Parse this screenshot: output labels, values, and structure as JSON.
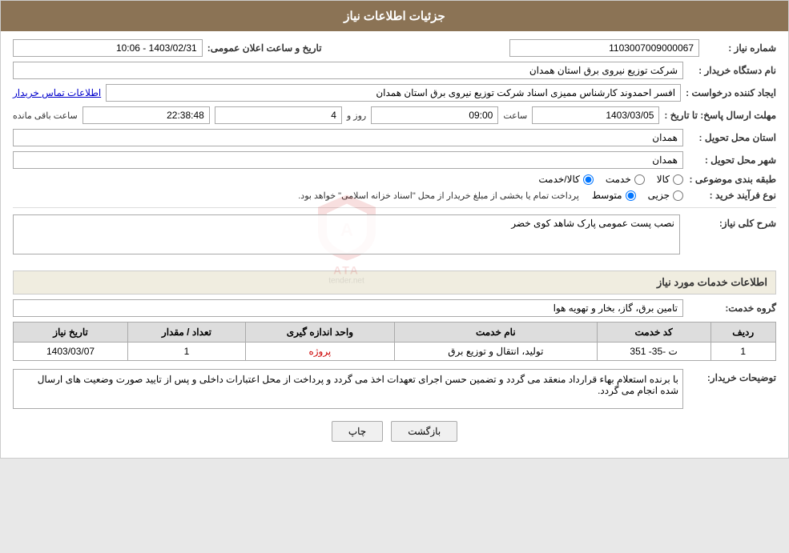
{
  "header": {
    "title": "جزئیات اطلاعات نیاز"
  },
  "fields": {
    "shomara_niaz_label": "شماره نیاز :",
    "shomara_niaz_value": "1103007009000067",
    "nam_dastgah_label": "نام دستگاه خریدار :",
    "nam_dastgah_value": "شرکت توزیع نیروی برق استان همدان",
    "ijad_konande_label": "ایجاد کننده درخواست :",
    "ijad_konande_value": "افسر احمدوند کارشناس ممیزی اسناد شرکت توزیع نیروی برق استان همدان",
    "ijad_konande_link": "اطلاعات تماس خریدار",
    "mohlat_label": "مهلت ارسال پاسخ: تا تاریخ :",
    "mohlat_date": "1403/03/05",
    "mohlat_saat_label": "ساعت",
    "mohlat_saat_value": "09:00",
    "mohlat_rooz_label": "روز و",
    "mohlat_rooz_value": "4",
    "mohlat_remaining_label": "ساعت باقی مانده",
    "mohlat_remaining_value": "22:38:48",
    "ostan_tahvil_label": "استان محل تحویل :",
    "ostan_tahvil_value": "همدان",
    "shahr_tahvil_label": "شهر محل تحویل :",
    "shahr_tahvil_value": "همدان",
    "tasnifbandi_label": "طبقه بندی موضوعی :",
    "tasnifbandi_kala": "کالا",
    "tasnifbandi_khedmat": "خدمت",
    "tasnifbandi_kala_khedmat": "کالا/خدمت",
    "nooe_farayand_label": "نوع فرآیند خرید :",
    "nooe_farayand_jazei": "جزیی",
    "nooe_farayand_mottavaset": "متوسط",
    "nooe_farayand_text": "پرداخت تمام یا بخشی از مبلغ خریدار از محل \"اسناد خزانه اسلامی\" خواهد بود.",
    "sharh_label": "شرح کلی نیاز:",
    "sharh_value": "نصب پست عمومی پارک شاهد کوی خضر",
    "etelaat_khadamat_label": "اطلاعات خدمات مورد نیاز",
    "gorohe_khedmat_label": "گروه خدمت:",
    "gorohe_khedmat_value": "تامین برق، گاز، بخار و تهویه هوا",
    "table": {
      "headers": [
        "ردیف",
        "کد خدمت",
        "نام خدمت",
        "واحد اندازه گیری",
        "تعداد / مقدار",
        "تاریخ نیاز"
      ],
      "rows": [
        {
          "radif": "1",
          "kod_khedmat": "ت -35- 351",
          "nam_khedmat": "تولید، انتقال و توزیع برق",
          "vahed": "پروژه",
          "tedaad": "1",
          "tarikh": "1403/03/07"
        }
      ]
    },
    "tawsif_label": "توضیحات خریدار:",
    "tawsif_value": "با برنده استعلام بهاء قرارداد منعقد می گردد و تضمین حسن اجرای تعهدات اخذ می گردد و پرداخت از محل اعتبارات داخلی و پس از تایید صورت وضعیت های ارسال شده انجام می گردد.",
    "tarikh_elan_label": "تاریخ و ساعت اعلان عمومی:",
    "tarikh_elan_value": "1403/02/31 - 10:06"
  },
  "buttons": {
    "print": "چاپ",
    "back": "بازگشت"
  }
}
